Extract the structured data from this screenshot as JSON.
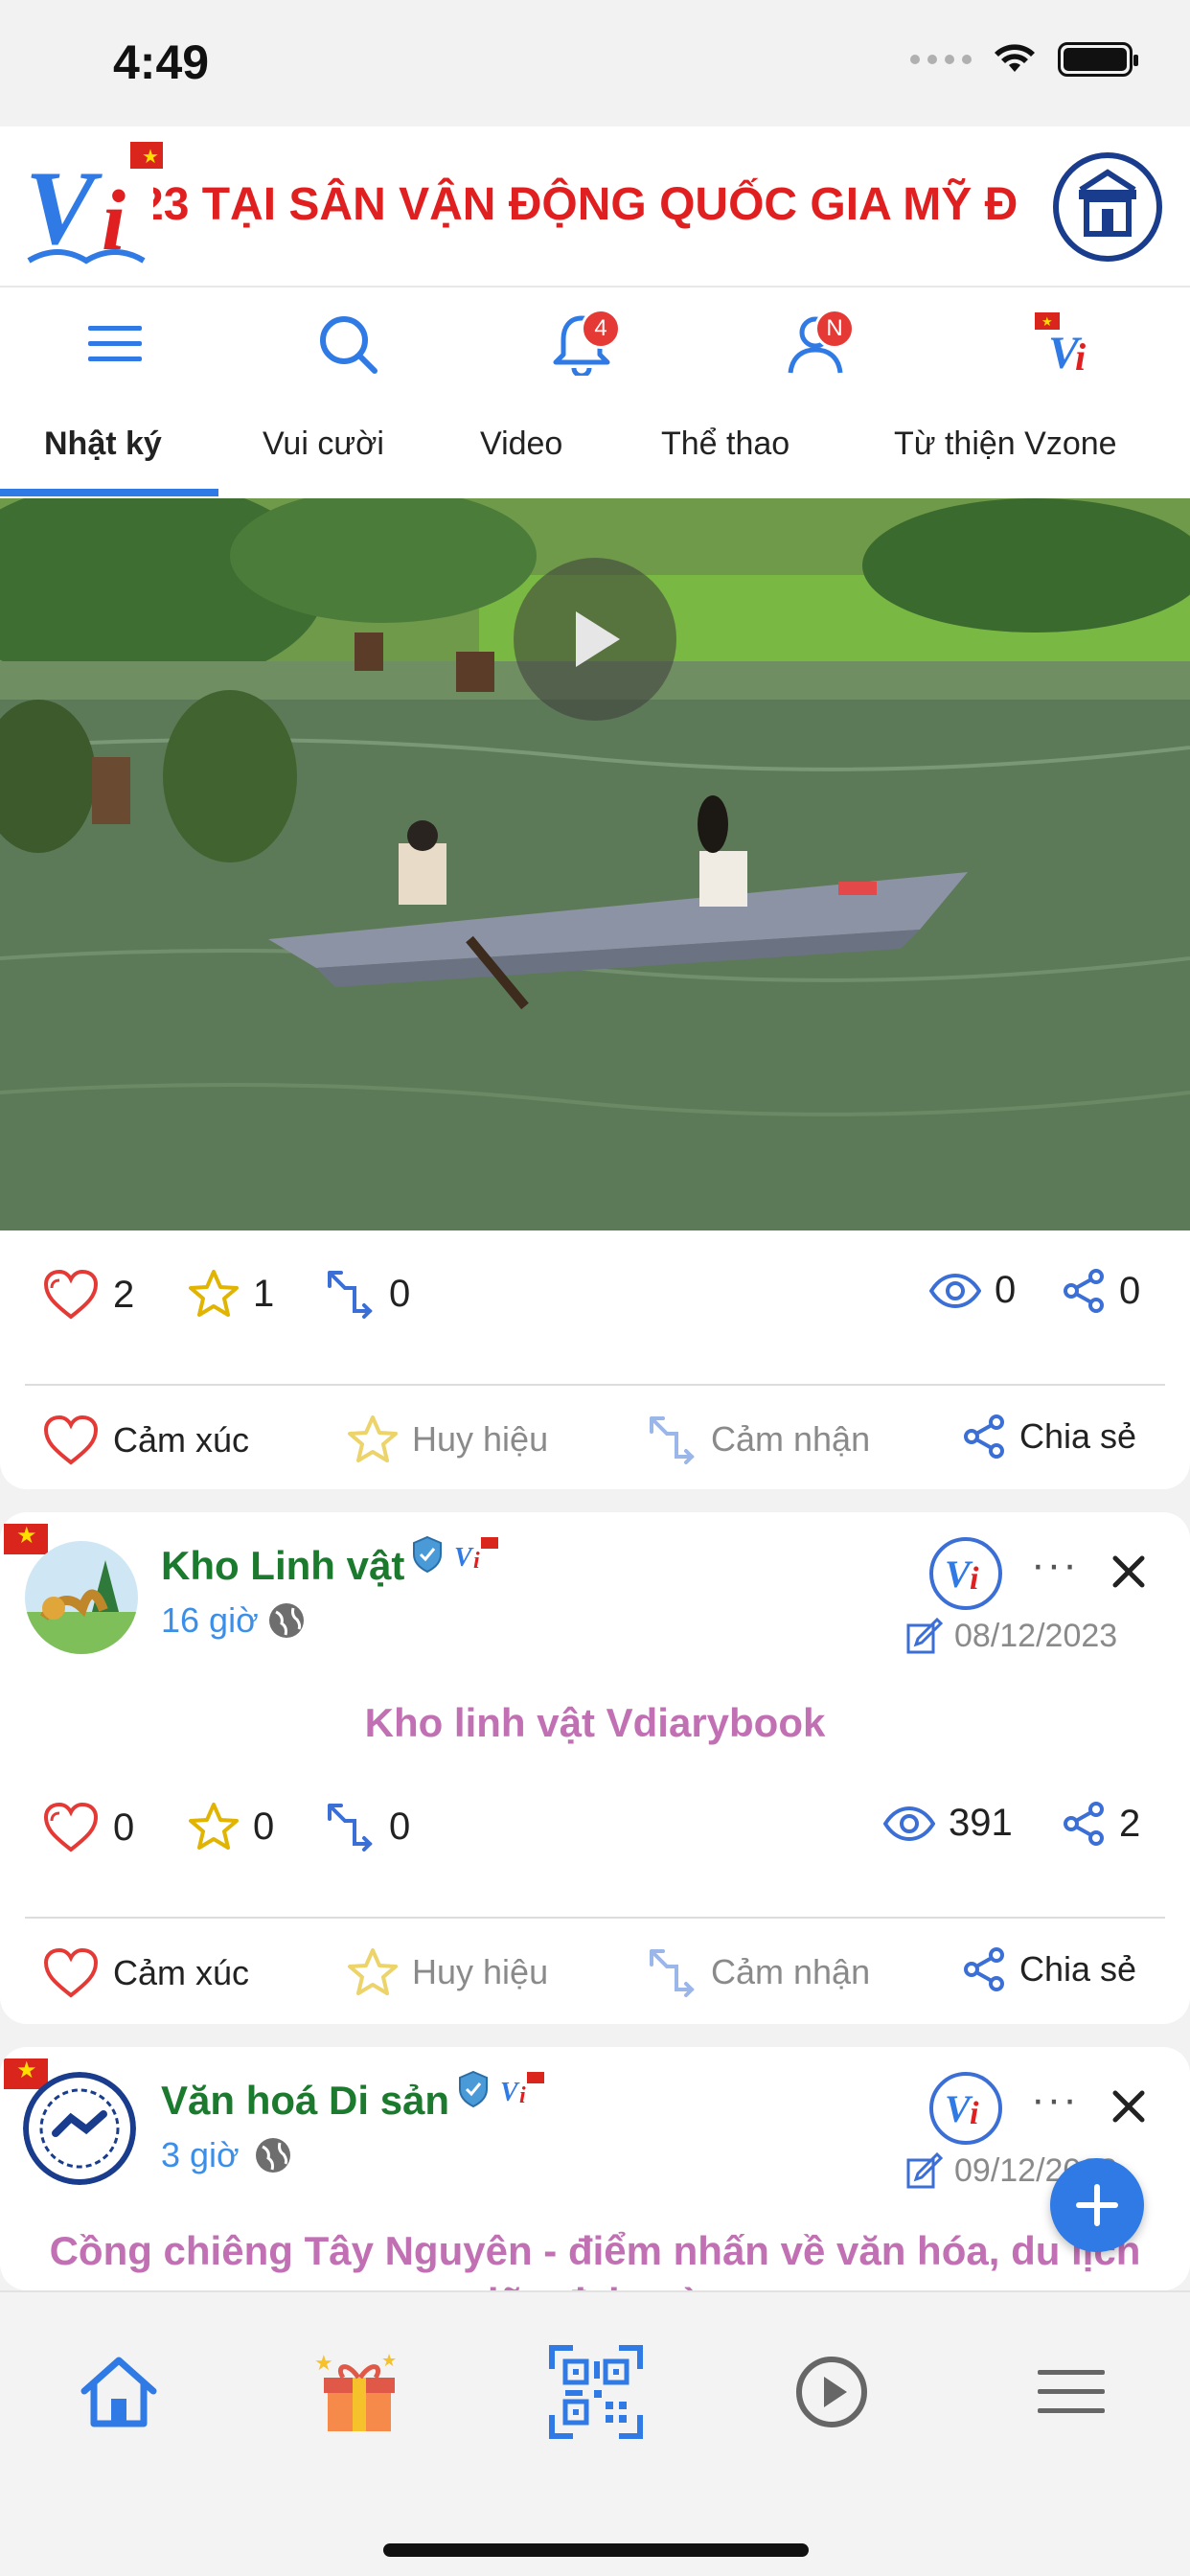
{
  "status_bar": {
    "time": "4:49"
  },
  "banner": {
    "marquee_text": "23 TẠI SÂN VẬN ĐỘNG QUỐC GIA MỸ Đ"
  },
  "toolbar": {
    "notifications_badge": "4",
    "profile_badge": "N"
  },
  "tabs": [
    {
      "label": "Nhật ký",
      "active": true
    },
    {
      "label": "Vui cười"
    },
    {
      "label": "Video"
    },
    {
      "label": "Thể thao"
    },
    {
      "label": "Từ thiện Vzone"
    }
  ],
  "post1": {
    "stats": {
      "likes": "2",
      "badges": "1",
      "comments": "0",
      "views": "0",
      "shares": "0"
    }
  },
  "actions": {
    "emotion": "Cảm xúc",
    "badge": "Huy hiệu",
    "comment": "Cảm nhận",
    "share": "Chia sẻ"
  },
  "post2": {
    "author": "Kho Linh vật",
    "time": "16 giờ",
    "date": "08/12/2023",
    "title": "Kho linh vật Vdiarybook",
    "stats": {
      "likes": "0",
      "badges": "0",
      "comments": "0",
      "views": "391",
      "shares": "2"
    }
  },
  "post3": {
    "author": "Văn hoá Di sản",
    "time": "3 giờ",
    "date": "09/12/2023",
    "title": "Cồng chiêng Tây Nguyên - điểm nhấn về văn hóa, du lịch giữa đại ngàn"
  },
  "colors": {
    "accent": "#2f7ae5",
    "author": "#1b7a2e",
    "title": "#c270b4",
    "badge": "#e53935",
    "banner_text": "#e02020"
  },
  "icons": {
    "toolbar": [
      "menu-icon",
      "search-icon",
      "bell-icon",
      "user-icon",
      "vzone-logo-icon"
    ],
    "bottom_nav": [
      "home-icon",
      "gift-icon",
      "qr-code-icon",
      "play-circle-icon",
      "hamburger-icon"
    ]
  }
}
